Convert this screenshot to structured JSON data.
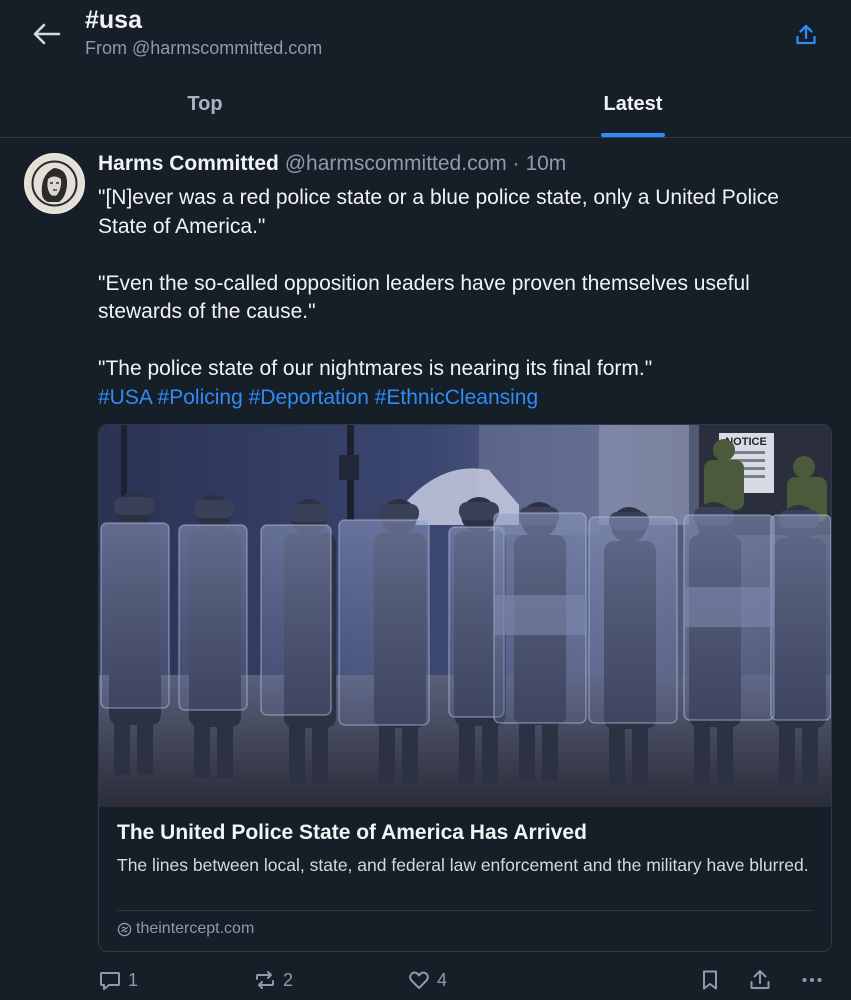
{
  "header": {
    "title": "#usa",
    "subtitle": "From @harmscommitted.com",
    "back_icon": "arrow-left-icon",
    "share_icon": "share-icon"
  },
  "tabs": [
    {
      "label": "Top",
      "active": false
    },
    {
      "label": "Latest",
      "active": true
    }
  ],
  "post": {
    "author": "Harms Committed",
    "handle": "@harmscommitted.com",
    "separator": "·",
    "time": "10m",
    "paragraphs": [
      "\"[N]ever was a red police state or a blue police state, only a United Police State of America.\"",
      "\"Even the so-called opposition leaders have proven themselves useful stewards of the cause.\"",
      "\"The police state of our nightmares is nearing its final form.\""
    ],
    "hashtags": [
      "#USA",
      "#Policing",
      "#Deportation",
      "#EthnicCleansing"
    ],
    "card": {
      "title": "The United Police State of America Has Arrived",
      "description": "The lines between local, state, and federal law enforcement and the military have blurred.",
      "domain": "theintercept.com",
      "sign_text": "NOTICE"
    },
    "actions": {
      "reply_count": "1",
      "repost_count": "2",
      "like_count": "4"
    }
  },
  "colors": {
    "background": "#161e27",
    "accent": "#2f8bf5",
    "muted": "#8e9baa",
    "border": "#2e3a47"
  }
}
